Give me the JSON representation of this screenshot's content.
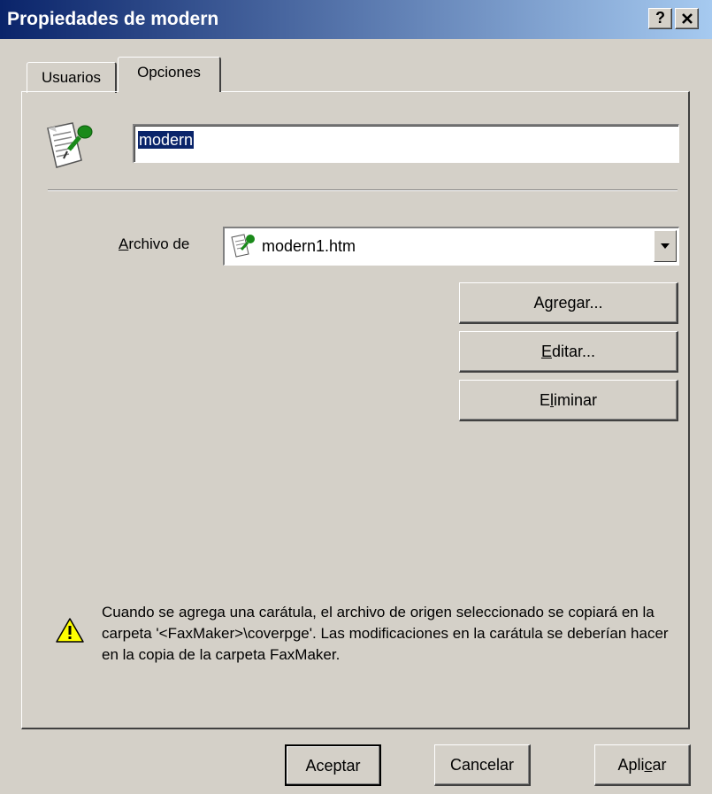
{
  "window": {
    "title": "Propiedades de modern",
    "help_button": "?",
    "close_button": "✕"
  },
  "tabs": [
    {
      "label": "Usuarios",
      "active": false
    },
    {
      "label": "Opciones",
      "active": true
    }
  ],
  "options": {
    "name_value": "modern",
    "file_label": "Archivo de",
    "file_selected": "modern1.htm",
    "buttons": {
      "add": "Agregar...",
      "edit": "Editar...",
      "delete": "Eliminar"
    },
    "note": "Cuando se agrega una carátula, el archivo de origen seleccionado se copiará en la carpeta '<FaxMaker>\\coverpge'. Las modificaciones en la carátula se deberían hacer en la copia de la carpeta FaxMaker."
  },
  "footer": {
    "ok": "Aceptar",
    "cancel": "Cancelar",
    "apply": "Aplicar"
  },
  "icons": {
    "cover_page": "cover-page-icon",
    "warning": "warning-icon",
    "dropdown": "chevron-down-icon"
  }
}
